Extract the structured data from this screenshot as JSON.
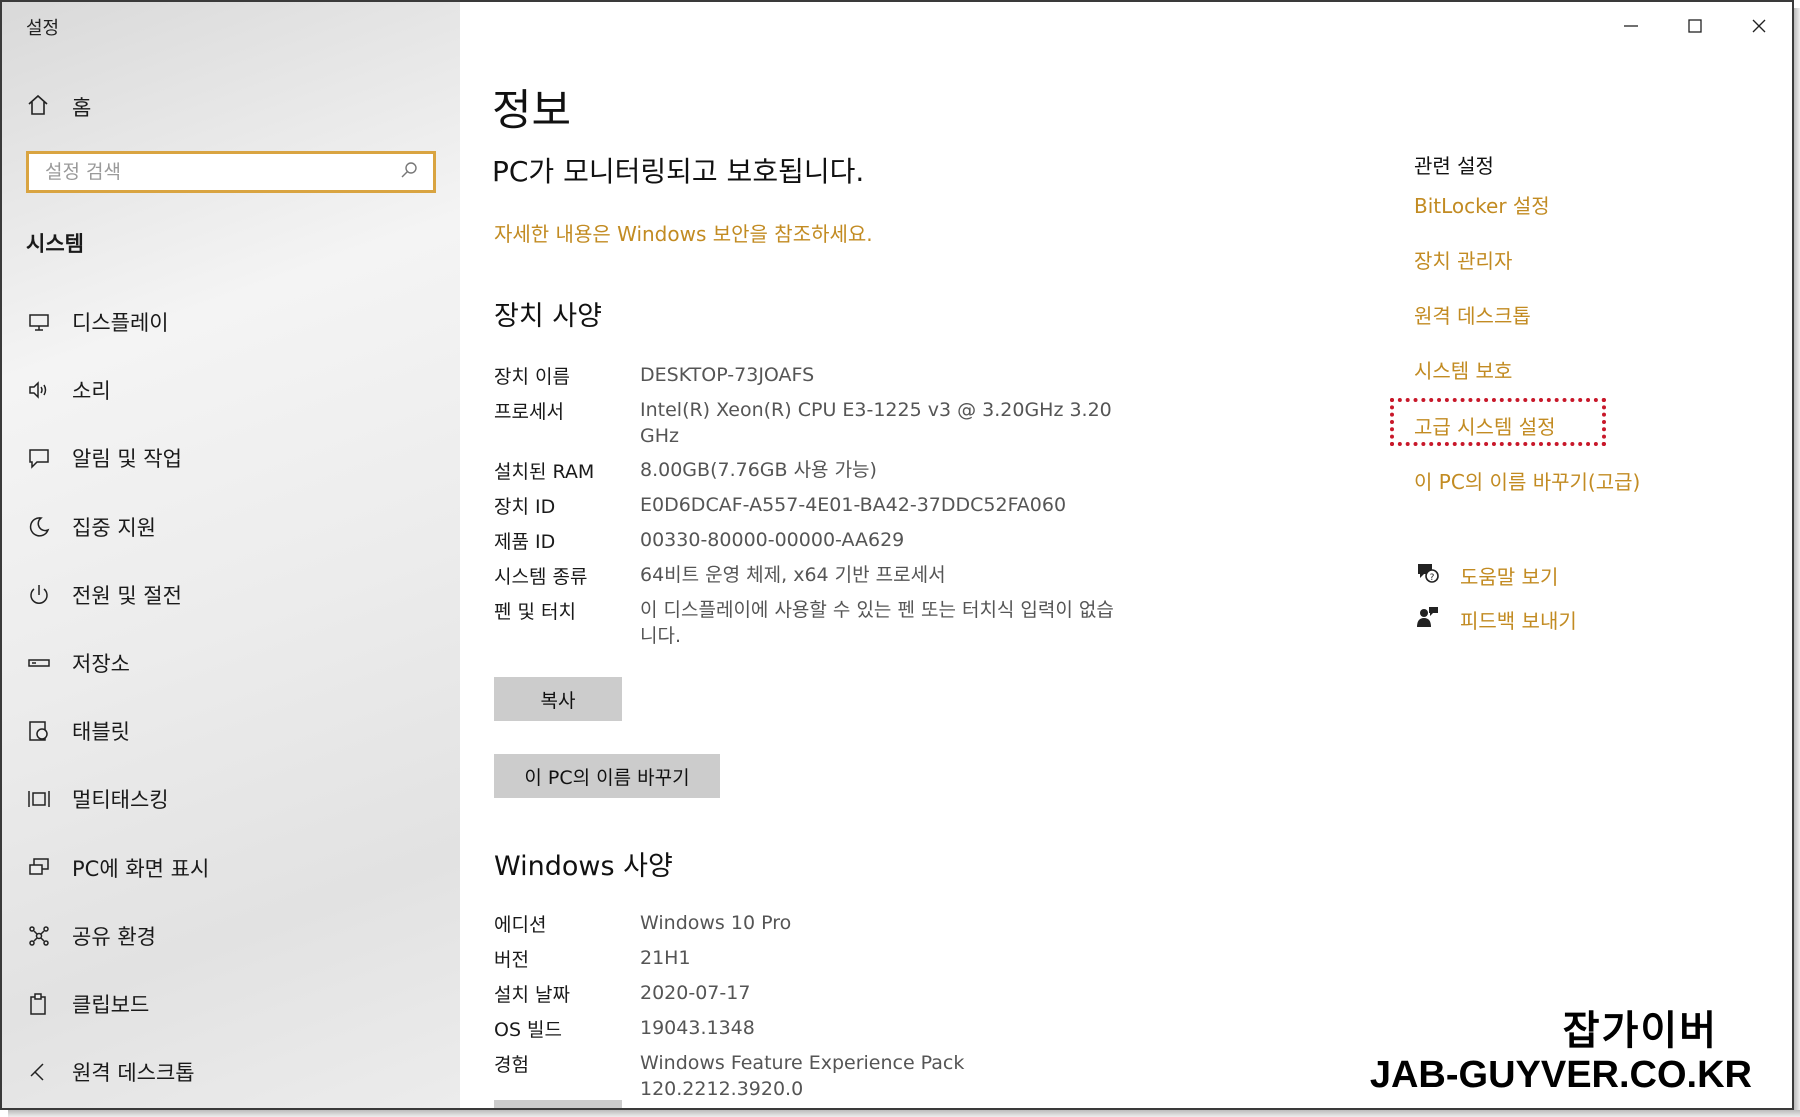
{
  "window": {
    "title": "설정",
    "controls": {
      "minimize": "minimize-icon",
      "maximize": "maximize-icon",
      "close": "close-icon"
    }
  },
  "sidebar": {
    "home_label": "홈",
    "search_placeholder": "설정 검색",
    "section_label": "시스템",
    "items": [
      {
        "label": "디스플레이",
        "icon": "display-icon"
      },
      {
        "label": "소리",
        "icon": "sound-icon"
      },
      {
        "label": "알림 및 작업",
        "icon": "notification-icon"
      },
      {
        "label": "집중 지원",
        "icon": "focus-assist-icon"
      },
      {
        "label": "전원 및 절전",
        "icon": "power-icon"
      },
      {
        "label": "저장소",
        "icon": "storage-icon"
      },
      {
        "label": "태블릿",
        "icon": "tablet-icon"
      },
      {
        "label": "멀티태스킹",
        "icon": "multitasking-icon"
      },
      {
        "label": "PC에 화면 표시",
        "icon": "project-icon"
      },
      {
        "label": "공유 환경",
        "icon": "shared-experiences-icon"
      },
      {
        "label": "클립보드",
        "icon": "clipboard-icon"
      },
      {
        "label": "원격 데스크톱",
        "icon": "remote-desktop-icon"
      }
    ]
  },
  "main": {
    "title": "정보",
    "status": "PC가 모니터링되고 보호됩니다.",
    "security_link": "자세한 내용은 Windows 보안을 참조하세요.",
    "device_specs": {
      "heading": "장치 사양",
      "rows": [
        {
          "key": "장치 이름",
          "value": "DESKTOP-73JOAFS"
        },
        {
          "key": "프로세서",
          "value": "Intel(R) Xeon(R) CPU E3-1225 v3 @ 3.20GHz   3.20 GHz"
        },
        {
          "key": "설치된 RAM",
          "value": "8.00GB(7.76GB 사용 가능)"
        },
        {
          "key": "장치 ID",
          "value": "E0D6DCAF-A557-4E01-BA42-37DDC52FA060"
        },
        {
          "key": "제품 ID",
          "value": "00330-80000-00000-AA629"
        },
        {
          "key": "시스템 종류",
          "value": "64비트 운영 체제, x64 기반 프로세서"
        },
        {
          "key": "펜 및 터치",
          "value": "이 디스플레이에 사용할 수 있는 펜 또는 터치식 입력이 없습니다."
        }
      ],
      "copy_button": "복사",
      "rename_button": "이 PC의 이름 바꾸기"
    },
    "windows_specs": {
      "heading": "Windows 사양",
      "rows": [
        {
          "key": "에디션",
          "value": "Windows 10 Pro"
        },
        {
          "key": "버전",
          "value": "21H1"
        },
        {
          "key": "설치 날짜",
          "value": "2020-07-17"
        },
        {
          "key": "OS 빌드",
          "value": "19043.1348"
        },
        {
          "key": "경험",
          "value": "Windows Feature Experience Pack 120.2212.3920.0"
        }
      ]
    }
  },
  "related": {
    "title": "관련 설정",
    "links": [
      "BitLocker 설정",
      "장치 관리자",
      "원격 데스크톱",
      "시스템 보호",
      "고급 시스템 설정",
      "이 PC의 이름 바꾸기(고급)"
    ],
    "help": {
      "label": "도움말 보기",
      "icon": "help-chat-icon"
    },
    "feedback": {
      "label": "피드백 보내기",
      "icon": "feedback-icon"
    }
  },
  "colors": {
    "accent": "#c28b22",
    "highlight_border": "#c8182a",
    "search_border": "#d9a441",
    "button_bg": "#cccccc"
  },
  "watermark": {
    "line1": "잡가이버",
    "line2": "JAB-GUYVER.CO.KR"
  }
}
